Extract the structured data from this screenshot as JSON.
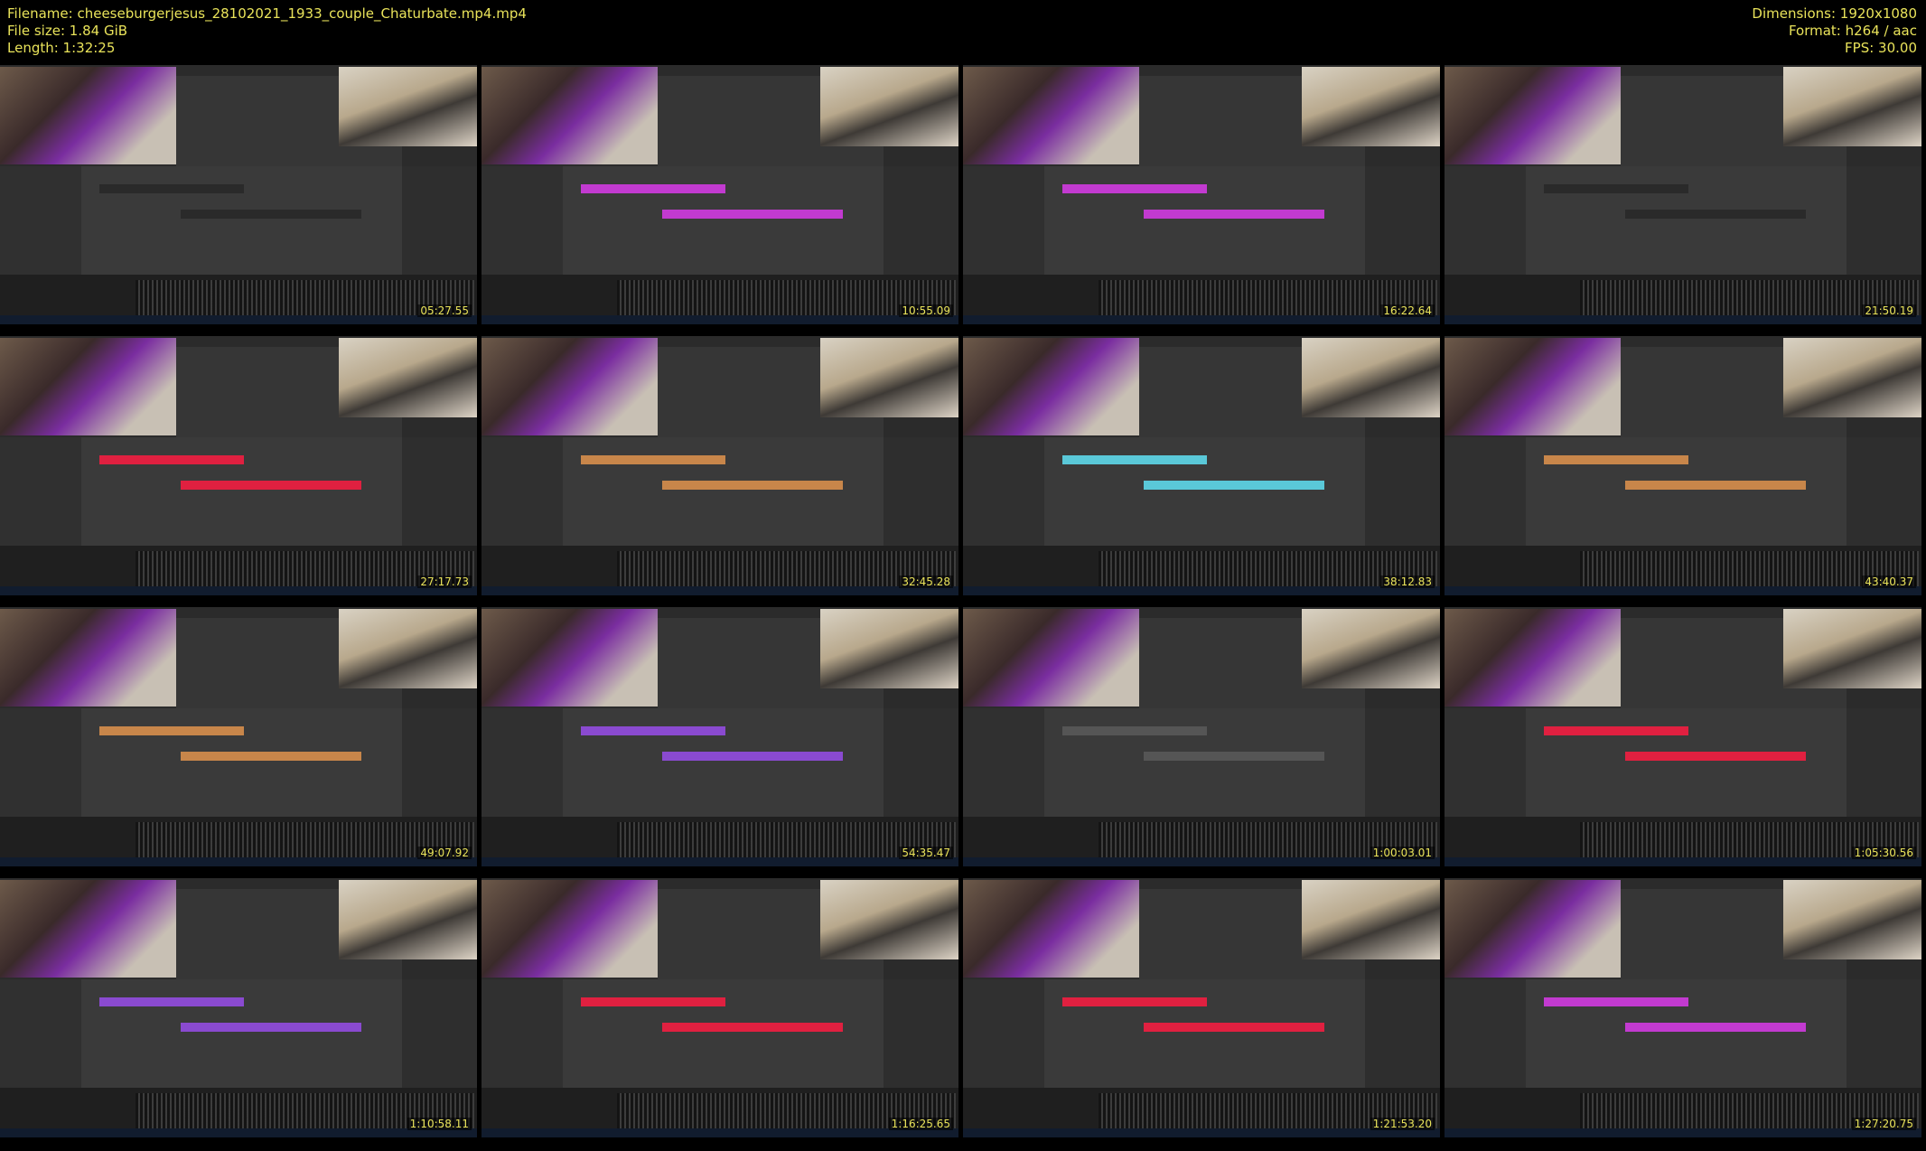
{
  "header": {
    "filename": "Filename: cheeseburgerjesus_28102021_1933_couple_Chaturbate.mp4.mp4",
    "filesize": "File size: 1.84 GiB",
    "length": "Length: 1:32:25",
    "dimensions": "Dimensions: 1920x1080",
    "format": "Format: h264 / aac",
    "fps": "FPS: 30.00"
  },
  "tiles": [
    {
      "timestamp": "05:27.55",
      "clip_color": "#2a2a2a"
    },
    {
      "timestamp": "10:55.09",
      "clip_color": "#c23ad0"
    },
    {
      "timestamp": "16:22.64",
      "clip_color": "#c23ad0"
    },
    {
      "timestamp": "21:50.19",
      "clip_color": "#2a2a2a"
    },
    {
      "timestamp": "27:17.73",
      "clip_color": "#e02040"
    },
    {
      "timestamp": "32:45.28",
      "clip_color": "#c8864a"
    },
    {
      "timestamp": "38:12.83",
      "clip_color": "#5ac8d8"
    },
    {
      "timestamp": "43:40.37",
      "clip_color": "#c8864a"
    },
    {
      "timestamp": "49:07.92",
      "clip_color": "#c8864a"
    },
    {
      "timestamp": "54:35.47",
      "clip_color": "#8a4ad0"
    },
    {
      "timestamp": "1:00:03.01",
      "clip_color": "#555555"
    },
    {
      "timestamp": "1:05:30.56",
      "clip_color": "#e02040"
    },
    {
      "timestamp": "1:10:58.11",
      "clip_color": "#8a4ad0"
    },
    {
      "timestamp": "1:16:25.65",
      "clip_color": "#e02040"
    },
    {
      "timestamp": "1:21:53.20",
      "clip_color": "#e02040"
    },
    {
      "timestamp": "1:27:20.75",
      "clip_color": "#c23ad0"
    }
  ]
}
